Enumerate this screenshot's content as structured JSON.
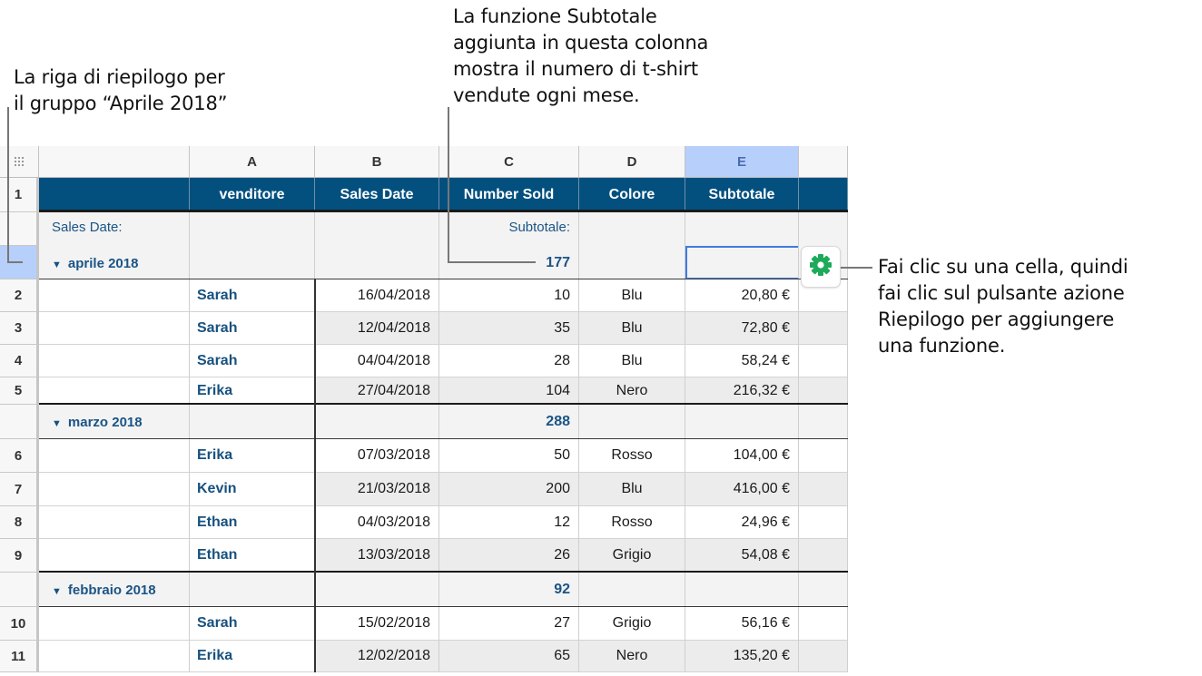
{
  "annotations": {
    "summary_row": [
      "La riga di riepilogo per",
      "il gruppo “Aprile 2018”"
    ],
    "subtotal_function": [
      "La funzione Subtotale",
      "aggiunta in questa colonna",
      "mostra il numero di t-shirt",
      "vendute ogni mese."
    ],
    "action_button": [
      "Fai clic su una cella, quindi",
      "fai clic sul pulsante azione",
      "Riepilogo per aggiungere",
      "una funzione."
    ]
  },
  "table": {
    "column_letters": [
      "A",
      "B",
      "C",
      "D",
      "E"
    ],
    "selected_column": "E",
    "headers": [
      "venditore",
      "Sales Date",
      "Number Sold",
      "Colore",
      "Subtotale"
    ],
    "header_row_number": "1",
    "summary_labels": {
      "group_label": "Sales Date:",
      "subtotal_label": "Subtotale:"
    },
    "groups": [
      {
        "name": "aprile 2018",
        "subtotal": "177",
        "rows": [
          {
            "num": "2",
            "venditore": "Sarah",
            "date": "16/04/2018",
            "sold": "10",
            "colore": "Blu",
            "subtotale": "20,80 €"
          },
          {
            "num": "3",
            "venditore": "Sarah",
            "date": "12/04/2018",
            "sold": "35",
            "colore": "Blu",
            "subtotale": "72,80 €"
          },
          {
            "num": "4",
            "venditore": "Sarah",
            "date": "04/04/2018",
            "sold": "28",
            "colore": "Blu",
            "subtotale": "58,24 €"
          },
          {
            "num": "5",
            "venditore": "Erika",
            "date": "27/04/2018",
            "sold": "104",
            "colore": "Nero",
            "subtotale": "216,32 €"
          }
        ]
      },
      {
        "name": "marzo 2018",
        "subtotal": "288",
        "rows": [
          {
            "num": "6",
            "venditore": "Erika",
            "date": "07/03/2018",
            "sold": "50",
            "colore": "Rosso",
            "subtotale": "104,00 €"
          },
          {
            "num": "7",
            "venditore": "Kevin",
            "date": "21/03/2018",
            "sold": "200",
            "colore": "Blu",
            "subtotale": "416,00 €"
          },
          {
            "num": "8",
            "venditore": "Ethan",
            "date": "04/03/2018",
            "sold": "12",
            "colore": "Rosso",
            "subtotale": "24,96 €"
          },
          {
            "num": "9",
            "venditore": "Ethan",
            "date": "13/03/2018",
            "sold": "26",
            "colore": "Grigio",
            "subtotale": "54,08 €"
          }
        ]
      },
      {
        "name": "febbraio 2018",
        "subtotal": "92",
        "rows": [
          {
            "num": "10",
            "venditore": "Sarah",
            "date": "15/02/2018",
            "sold": "27",
            "colore": "Grigio",
            "subtotale": "56,16 €"
          },
          {
            "num": "11",
            "venditore": "Erika",
            "date": "12/02/2018",
            "sold": "65",
            "colore": "Nero",
            "subtotale": "135,20 €"
          }
        ]
      }
    ]
  },
  "icons": {
    "table_handle": "grid-dots-icon",
    "action_button": "gear-icon",
    "collapse": "disclosure-triangle-icon"
  },
  "colors": {
    "header_bg": "#03507f",
    "accent_text": "#17517f",
    "selection": "#b7cffb",
    "gear": "#1daa5a"
  }
}
